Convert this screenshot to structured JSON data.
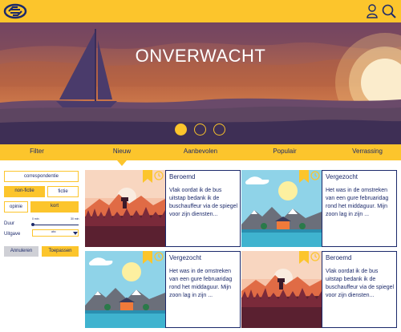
{
  "header": {
    "logo_icon": "ns-logo-icon",
    "user_icon": "user-icon",
    "search_icon": "search-icon"
  },
  "hero": {
    "title": "ONVERWACHT",
    "carousel": {
      "count": 3,
      "active_index": 0
    }
  },
  "tabs": [
    {
      "label": "Filter"
    },
    {
      "label": "Nieuw"
    },
    {
      "label": "Aanbevolen"
    },
    {
      "label": "Populair"
    },
    {
      "label": "Verrassing"
    }
  ],
  "filter": {
    "correspondentie": "correspondentie",
    "non_fictie": "non-fictie",
    "fictie": "fictie",
    "opinie": "opinie",
    "kort": "kort",
    "duur_label": "Duur",
    "duur_min": "0 min",
    "duur_max": "30 min",
    "uitgave_label": "Uitgave",
    "uitgave_value": "abc",
    "annuleren": "Annuleren",
    "toepassen": "Toepassen"
  },
  "cards": [
    {
      "title": "Beroemd",
      "body": "Vlak oordat ik de bus uitstap bedank ik de buschauffeur via de spiegel voor zijn diensten...",
      "thumb": "sunset"
    },
    {
      "title": "Vergezocht",
      "body": "Het was in de omstreken van een gure februaridag rond het middaguur. Mijn zoon lag in zijn ...",
      "thumb": "day"
    },
    {
      "title": "Vergezocht",
      "body": "Het was in de omstreken van een gure februaridag rond het middaguur. Mijn zoon lag in zijn ...",
      "thumb": "day"
    },
    {
      "title": "Beroemd",
      "body": "Vlak oordat ik de bus uitstap bedank ik de buschauffeur via de spiegel voor zijn diensten...",
      "thumb": "sunset"
    }
  ],
  "colors": {
    "brand_yellow": "#fcc52c",
    "navy": "#1c2a6b"
  }
}
